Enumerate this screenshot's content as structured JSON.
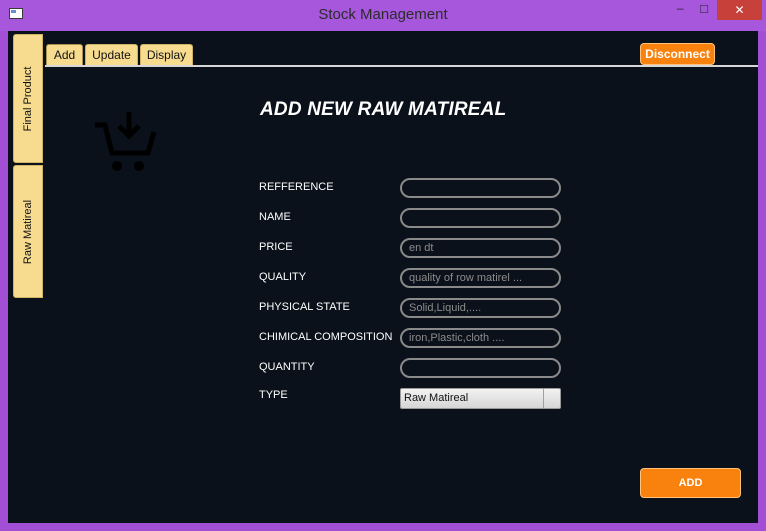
{
  "window": {
    "title": "Stock Management",
    "min": "─",
    "max": "☐",
    "close": "✕"
  },
  "side_tabs": {
    "final_product": "Final Product",
    "raw_matireal": "Raw Matireal"
  },
  "top_tabs": {
    "add": "Add",
    "update": "Update",
    "display": "Display"
  },
  "toolbar": {
    "disconnect": "Disconnect"
  },
  "icons": {
    "cart": "cart-download-icon"
  },
  "form": {
    "title": "ADD NEW RAW MATIREAL",
    "reference_label": "REFFERENCE",
    "reference_value": "",
    "name_label": "NAME",
    "name_value": "",
    "price_label": "PRICE",
    "price_placeholder": "en dt",
    "quality_label": "QUALITY",
    "quality_placeholder": "quality of row matirel ...",
    "physical_label": "PHYSICAL STATE",
    "physical_placeholder": "Solid,Liquid,....",
    "chemical_label": "CHIMICAL COMPOSITION",
    "chemical_placeholder": "iron,Plastic,cloth ....",
    "quantity_label": "QUANTITY",
    "quantity_value": "",
    "type_label": "TYPE",
    "type_selected": "Raw Matireal",
    "add_button": "ADD"
  },
  "colors": {
    "accent": "#f8820d",
    "tab": "#f7dc8f",
    "background": "#0a111a",
    "frame": "#a24fd6"
  }
}
